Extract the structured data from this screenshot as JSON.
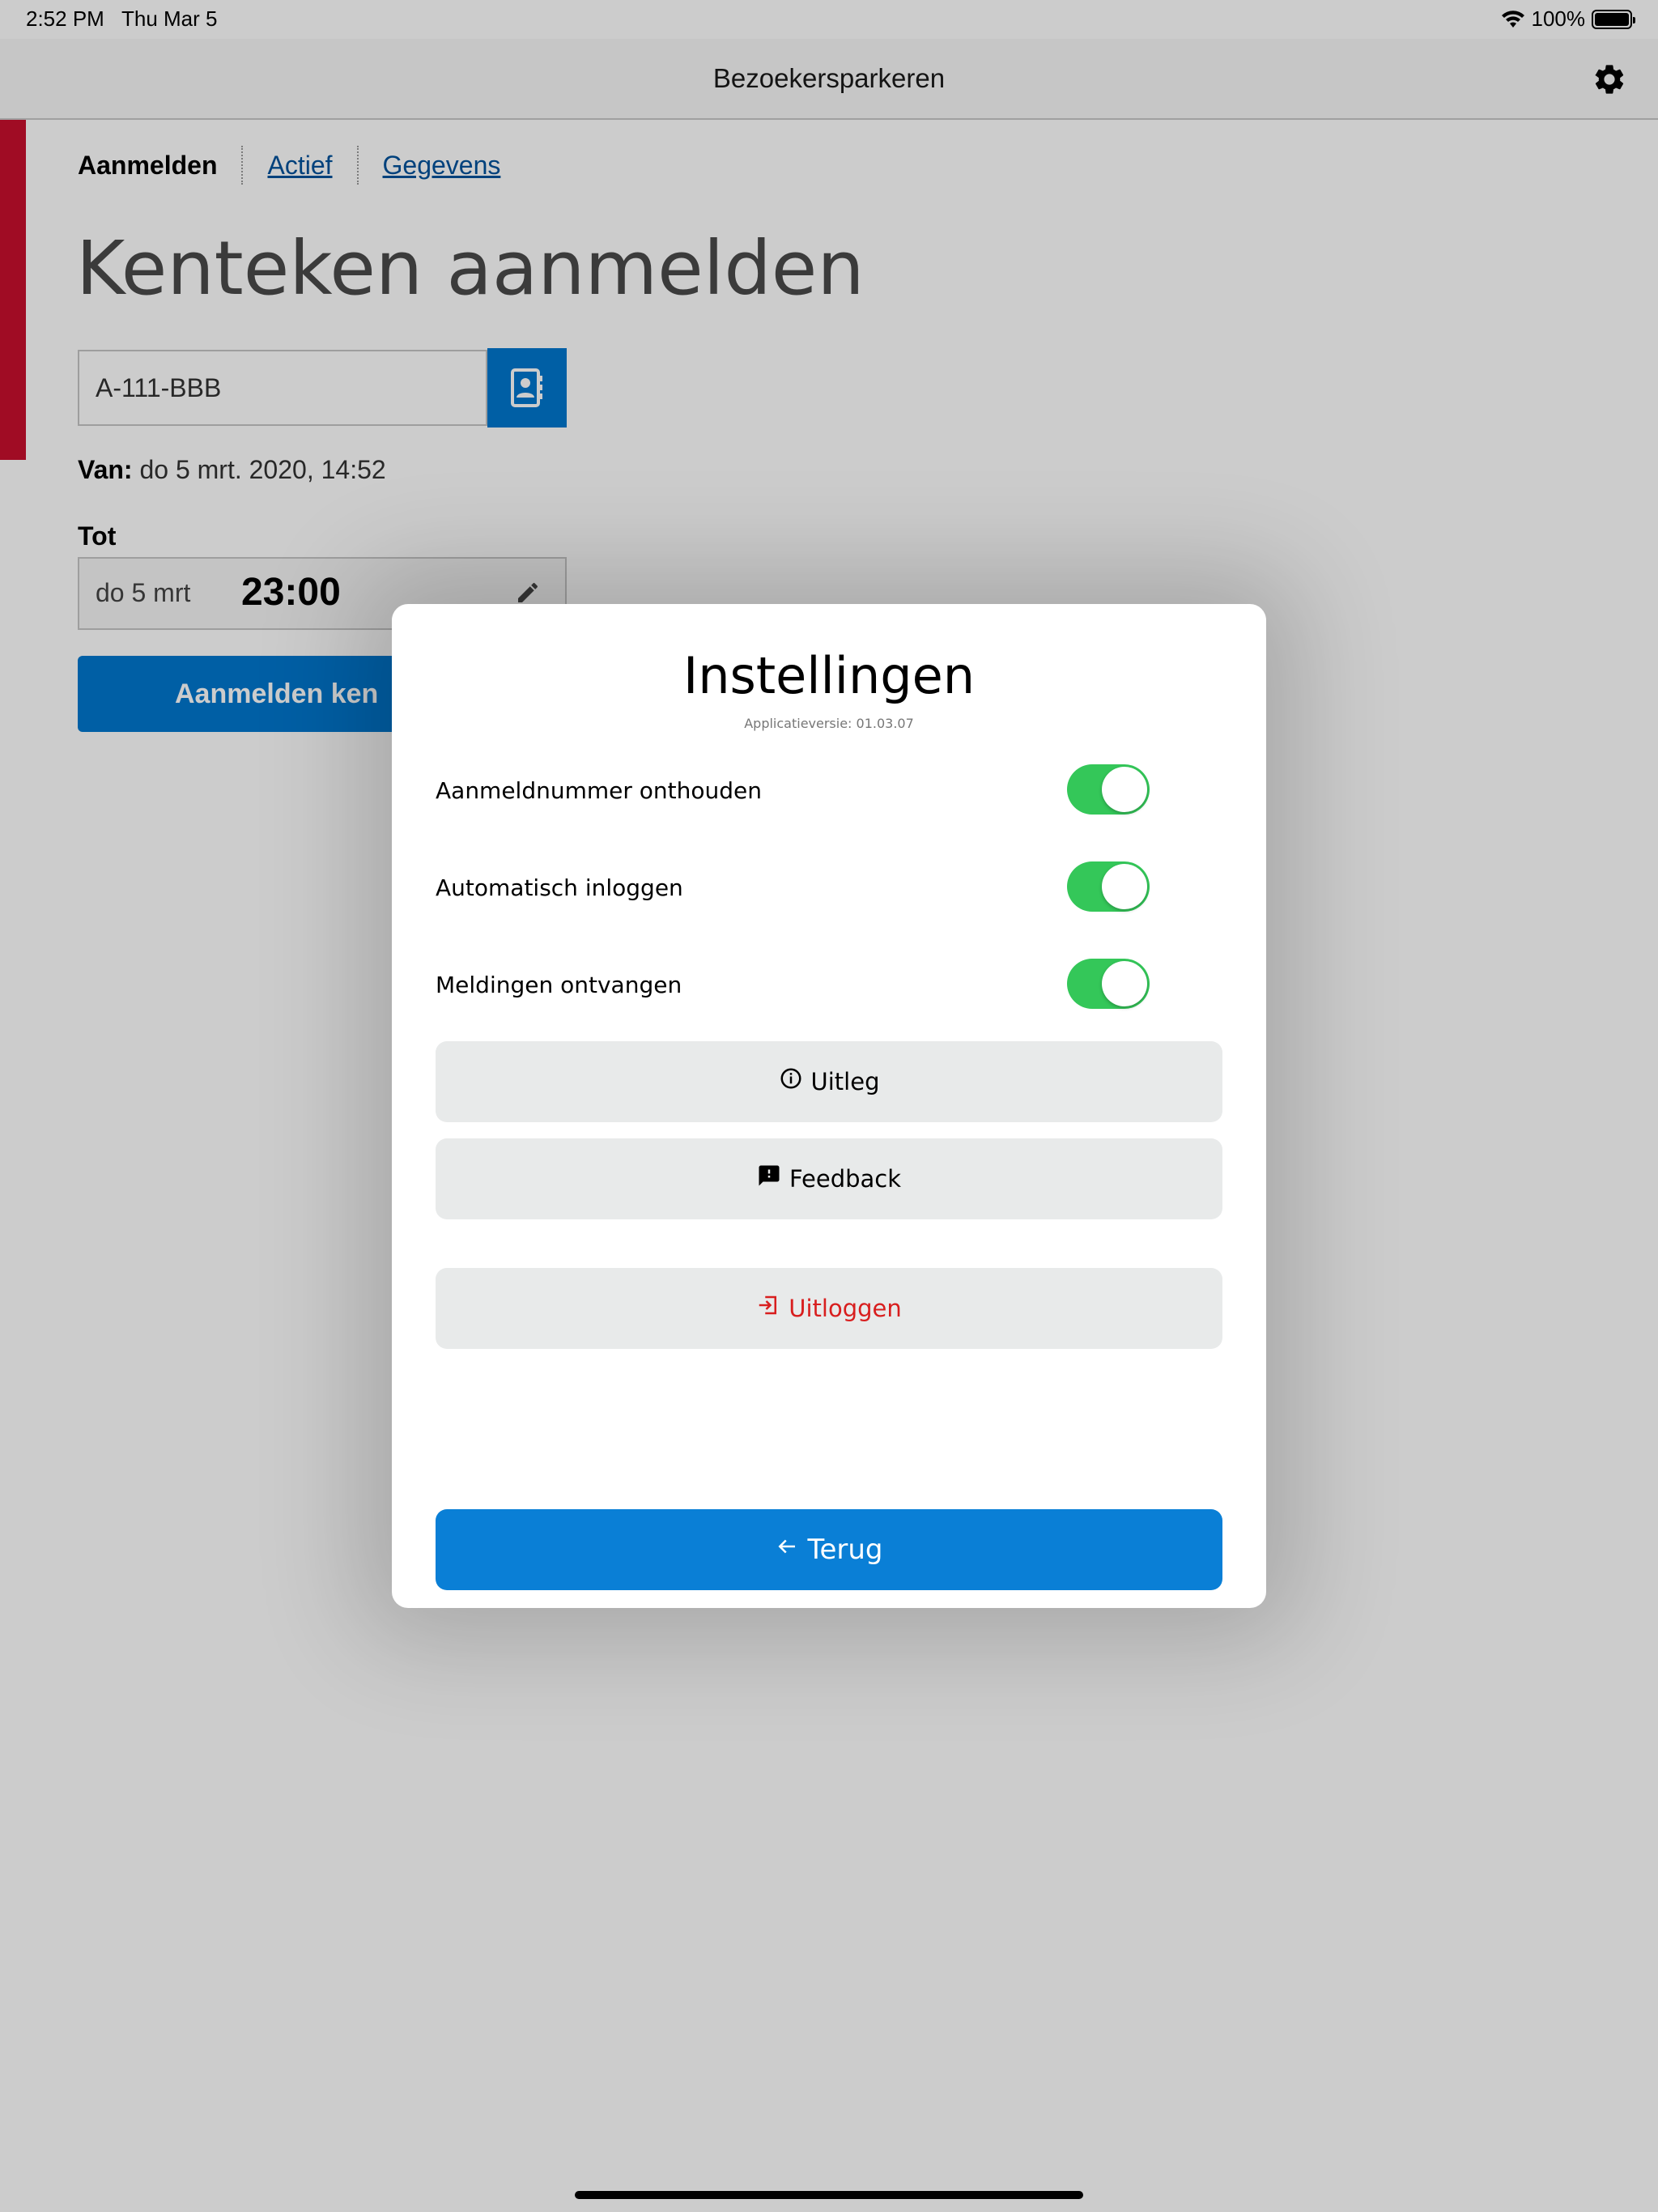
{
  "status_bar": {
    "time": "2:52 PM",
    "date": "Thu Mar 5",
    "battery": "100%"
  },
  "nav": {
    "title": "Bezoekersparkeren",
    "settings_icon": "gear-icon"
  },
  "tabs": [
    {
      "label": "Aanmelden",
      "active": true
    },
    {
      "label": "Actief",
      "active": false
    },
    {
      "label": "Gegevens",
      "active": false
    }
  ],
  "page": {
    "title": "Kenteken aanmelden",
    "plate_value": "A-111-BBB",
    "contacts_icon": "address-book-icon",
    "van_label": "Van:",
    "van_value": "do 5 mrt. 2020, 14:52",
    "tot_label": "Tot",
    "tot_date": "do 5 mrt",
    "tot_time": "23:00",
    "submit_label": "Aanmelden ken"
  },
  "modal": {
    "title": "Instellingen",
    "version": "Applicatieversie: 01.03.07",
    "settings": [
      {
        "label": "Aanmeldnummer onthouden",
        "on": true
      },
      {
        "label": "Automatisch inloggen",
        "on": true
      },
      {
        "label": "Meldingen ontvangen",
        "on": true
      }
    ],
    "buttons": {
      "uitleg": "Uitleg",
      "feedback": "Feedback",
      "uitloggen": "Uitloggen",
      "terug": "Terug"
    }
  },
  "colors": {
    "brand_blue": "#0077cf",
    "accent_red": "#c8102e",
    "toggle_green": "#34c759",
    "danger_red": "#d81e1e"
  }
}
